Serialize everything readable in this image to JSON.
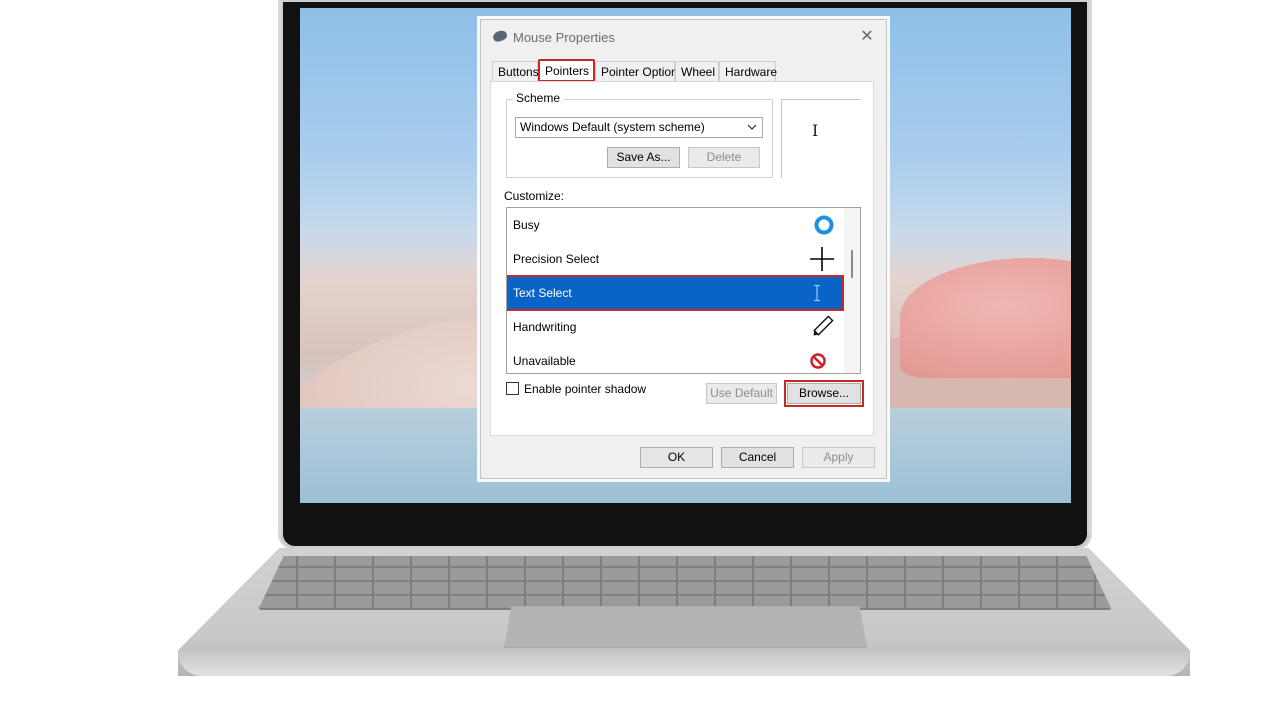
{
  "dialog": {
    "title": "Mouse Properties",
    "close_glyph": "✕",
    "tabs": [
      {
        "label": "Buttons"
      },
      {
        "label": "Pointers",
        "active": true
      },
      {
        "label": "Pointer Options"
      },
      {
        "label": "Wheel"
      },
      {
        "label": "Hardware"
      }
    ],
    "scheme": {
      "group_label": "Scheme",
      "selected": "Windows Default (system scheme)",
      "save_as_label": "Save As...",
      "delete_label": "Delete"
    },
    "preview_glyph": "I",
    "customize_label": "Customize:",
    "pointer_list": [
      {
        "name": "Busy",
        "icon": "busy-ring-icon"
      },
      {
        "name": "Precision Select",
        "icon": "crosshair-icon"
      },
      {
        "name": "Text Select",
        "icon": "ibeam-icon",
        "selected": true
      },
      {
        "name": "Handwriting",
        "icon": "pen-icon"
      },
      {
        "name": "Unavailable",
        "icon": "unavailable-icon"
      }
    ],
    "enable_shadow_label": "Enable pointer shadow",
    "use_default_label": "Use Default",
    "browse_label": "Browse...",
    "ok_label": "OK",
    "cancel_label": "Cancel",
    "apply_label": "Apply"
  },
  "colors": {
    "highlight": "#c62828",
    "selection": "#0a64c8",
    "busy": "#1e90e0",
    "unavailable": "#d11a2a"
  }
}
